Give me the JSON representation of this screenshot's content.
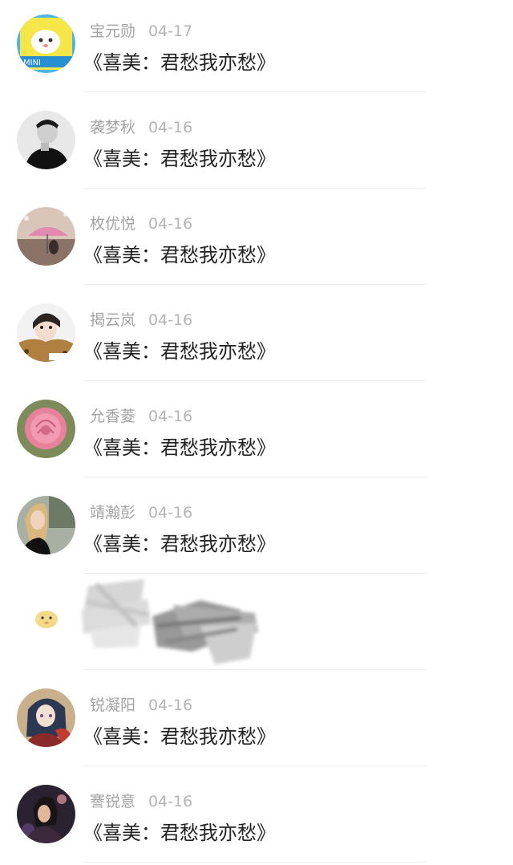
{
  "comments": [
    {
      "name": "宝元勋",
      "date": "04-17",
      "text": "《喜美：君愁我亦愁》",
      "avatar_icon": "cartoon-mascot-avatar"
    },
    {
      "name": "袭梦秋",
      "date": "04-16",
      "text": "《喜美：君愁我亦愁》",
      "avatar_icon": "man-portrait-avatar"
    },
    {
      "name": "枚优悦",
      "date": "04-16",
      "text": "《喜美：君愁我亦愁》",
      "avatar_icon": "umbrella-girl-avatar"
    },
    {
      "name": "揭云岚",
      "date": "04-16",
      "text": "《喜美：君愁我亦愁》",
      "avatar_icon": "girl-selfie-avatar"
    },
    {
      "name": "允香菱",
      "date": "04-16",
      "text": "《喜美：君愁我亦愁》",
      "avatar_icon": "pink-rose-avatar"
    },
    {
      "name": "靖瀚彭",
      "date": "04-16",
      "text": "《喜美：君愁我亦愁》",
      "avatar_icon": "woman-blonde-avatar"
    },
    {
      "name": "",
      "date": "",
      "text": "",
      "avatar_icon": "small-mascot-avatar",
      "redacted": true
    },
    {
      "name": "锐凝阳",
      "date": "04-16",
      "text": "《喜美：君愁我亦愁》",
      "avatar_icon": "anime-character-avatar"
    },
    {
      "name": "謇锐意",
      "date": "04-16",
      "text": "《喜美：君愁我亦愁》",
      "avatar_icon": "night-portrait-avatar"
    }
  ]
}
